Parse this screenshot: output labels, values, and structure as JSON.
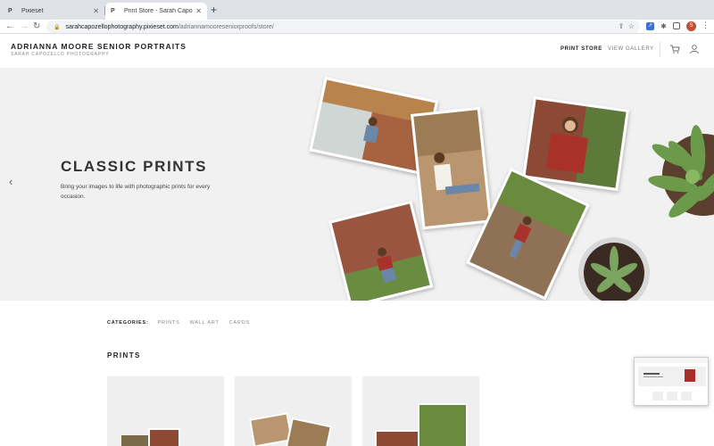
{
  "browser": {
    "tabs": [
      {
        "favicon": "P",
        "title": "Pixieset",
        "close": "✕"
      },
      {
        "favicon": "P",
        "title": "Print Store - Sarah Capozello P",
        "close": "✕"
      }
    ],
    "new_tab": "+",
    "url_host": "sarahcapozellophotography.pixieset.com",
    "url_path": "/adriannamooreseniorproofs/store/",
    "profile_initial": "S"
  },
  "site": {
    "title": "ADRIANNA MOORE SENIOR PORTRAITS",
    "subtitle": "SARAH CAPOZELLO PHOTOGRAPHY",
    "nav": [
      {
        "label": "PRINT STORE",
        "active": true
      },
      {
        "label": "VIEW GALLERY",
        "active": false
      }
    ]
  },
  "hero": {
    "title": "CLASSIC PRINTS",
    "subtitle": "Bring your images to life with photographic prints for every occasion."
  },
  "categories": {
    "label": "CATEGORIES:",
    "items": [
      "PRINTS",
      "WALL ART",
      "CARDS"
    ]
  },
  "section": {
    "title": "PRINTS"
  },
  "colors": {
    "hero_bg": "#f1f1f1",
    "profile": "#c0502f",
    "plant_green": "#6a9a4a",
    "sweater_red": "#a8302a"
  }
}
